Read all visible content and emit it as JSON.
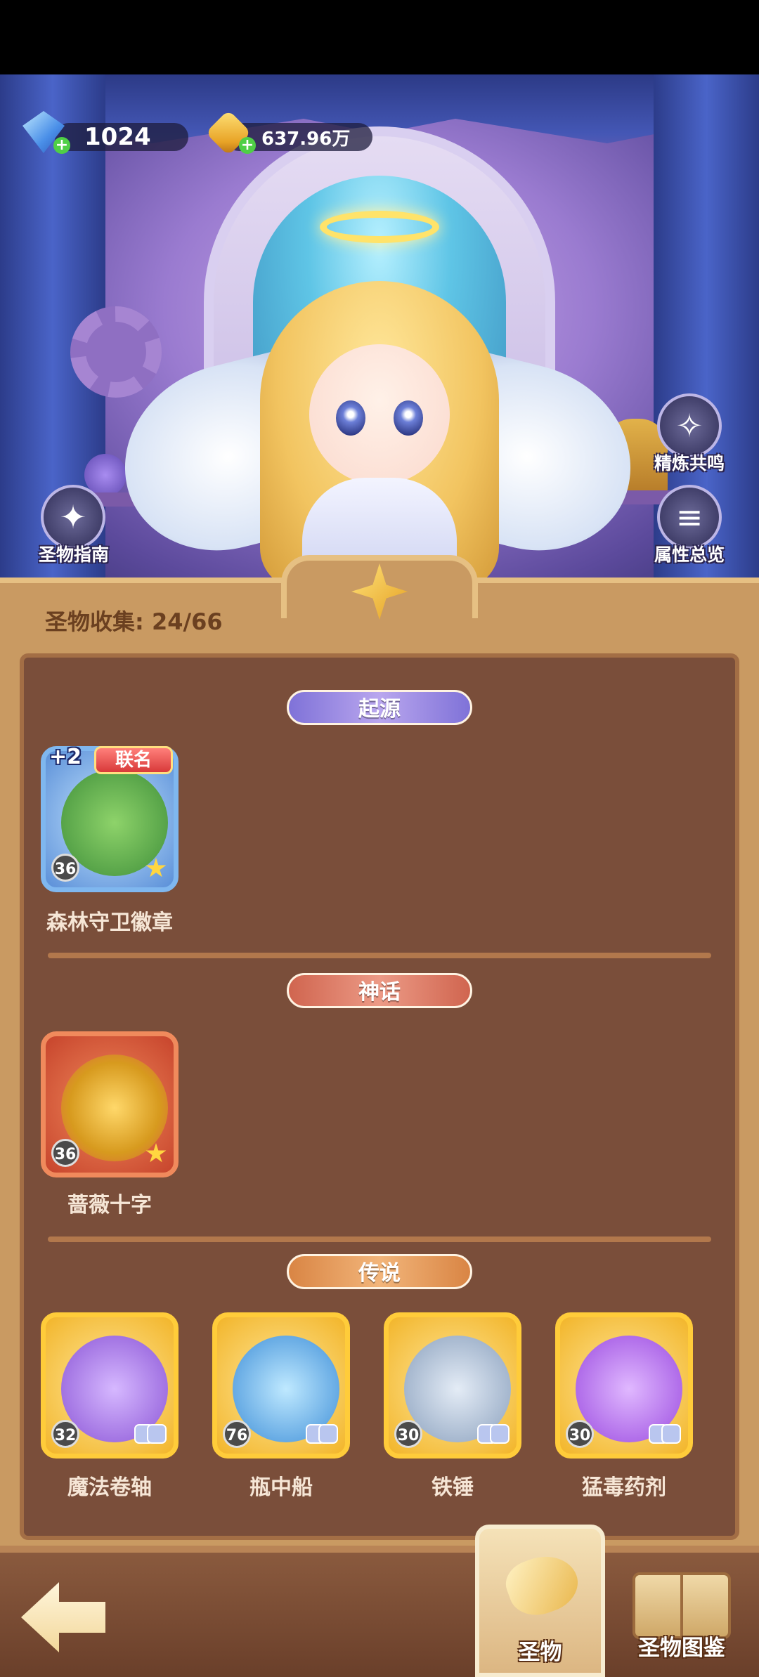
{
  "currency": {
    "gems": "1024",
    "gold": "637.96万",
    "gem_icon": "diamond-gem-icon",
    "gold_icon": "gold-coin-icon",
    "add_symbol": "+"
  },
  "side_buttons": {
    "guide_label": "圣物指南",
    "resonance_label": "精炼共鸣",
    "attributes_label": "属性总览"
  },
  "collection": {
    "label": "圣物收集: 24/66"
  },
  "sections": [
    {
      "title": "起源",
      "items": [
        {
          "name": "森林守卫徽章",
          "level": "36",
          "badge_plus": "+2",
          "badge_tag": "联名"
        }
      ]
    },
    {
      "title": "神话",
      "items": [
        {
          "name": "蔷薇十字",
          "level": "36"
        }
      ]
    },
    {
      "title": "传说",
      "items": [
        {
          "name": "魔法卷轴",
          "level": "32"
        },
        {
          "name": "瓶中船",
          "level": "76"
        },
        {
          "name": "铁锤",
          "level": "30"
        },
        {
          "name": "猛毒药剂",
          "level": "30"
        }
      ]
    }
  ],
  "bottom_nav": {
    "tab_relic": "圣物",
    "tab_codex": "圣物图鉴"
  },
  "colors": {
    "panel": "#c99a62",
    "inner_panel": "#7a4e3a",
    "origin": "#7f72d8",
    "myth": "#d0654f",
    "legend": "#d98544"
  }
}
